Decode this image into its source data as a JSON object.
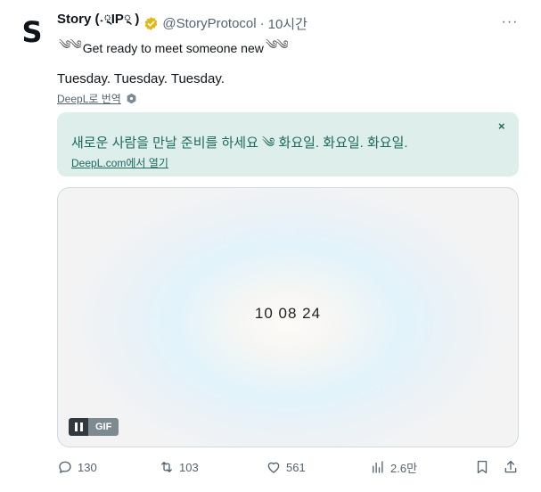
{
  "author": {
    "avatar_letter": "S",
    "name": "Story (˖྄IP྄ )",
    "handle": "@StoryProtocol",
    "separator": "·",
    "time": "10시간",
    "verified_color": "#e2b719"
  },
  "more_label": "···",
  "tweet": {
    "doodle_left": "༄༄",
    "line1": "Get ready to meet someone new",
    "doodle_right": "༄༄",
    "line2": "Tuesday. Tuesday. Tuesday."
  },
  "translate": {
    "link_label": "DeepL로 번역",
    "translated_text": "새로운 사람을 만날 준비를 하세요 ༄ 화요일. 화요일. 화요일.",
    "close_label": "×",
    "open_label": "DeepL.com에서 열기"
  },
  "media": {
    "date_text": "10 08 24",
    "gif_label": "GIF"
  },
  "actions": {
    "replies": "130",
    "retweets": "103",
    "likes": "561",
    "views": "2.6만"
  },
  "colors": {
    "translation_bg": "#deeeea",
    "translation_text": "#1a6a5e",
    "secondary_text": "#536471"
  }
}
